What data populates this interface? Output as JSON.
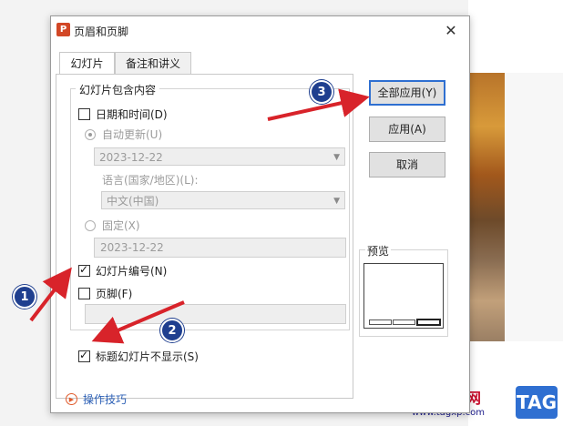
{
  "dialog": {
    "app_icon": "P",
    "title": "页眉和页脚",
    "close_glyph": "✕"
  },
  "tabs": [
    {
      "label": "幻灯片",
      "active": true
    },
    {
      "label": "备注和讲义",
      "active": false
    }
  ],
  "slide_panel": {
    "group_label": "幻灯片包含内容",
    "date_time": {
      "label": "日期和时间(D)",
      "checked": false
    },
    "auto_update": {
      "label": "自动更新(U)",
      "selected": true,
      "value": "2023-12-22"
    },
    "language_label": "语言(国家/地区)(L):",
    "language_value": "中文(中国)",
    "fixed": {
      "label": "固定(X)",
      "selected": false,
      "value": "2023-12-22"
    },
    "slide_number": {
      "label": "幻灯片编号(N)",
      "checked": true
    },
    "footer": {
      "label": "页脚(F)",
      "checked": false,
      "value": ""
    },
    "hide_on_title": {
      "label": "标题幻灯片不显示(S)",
      "checked": true
    }
  },
  "buttons": {
    "apply_all": "全部应用(Y)",
    "apply": "应用(A)",
    "cancel": "取消"
  },
  "preview": {
    "label": "预览"
  },
  "tips": {
    "label": "操作技巧"
  },
  "annotations": {
    "step1": "1",
    "step2": "2",
    "step3": "3",
    "arrow_color": "#d8232a",
    "badge_color": "#1f3f8f"
  },
  "watermark": {
    "site": "电脑技术网",
    "url": "www.tagxp.com",
    "tag": "TAG"
  }
}
